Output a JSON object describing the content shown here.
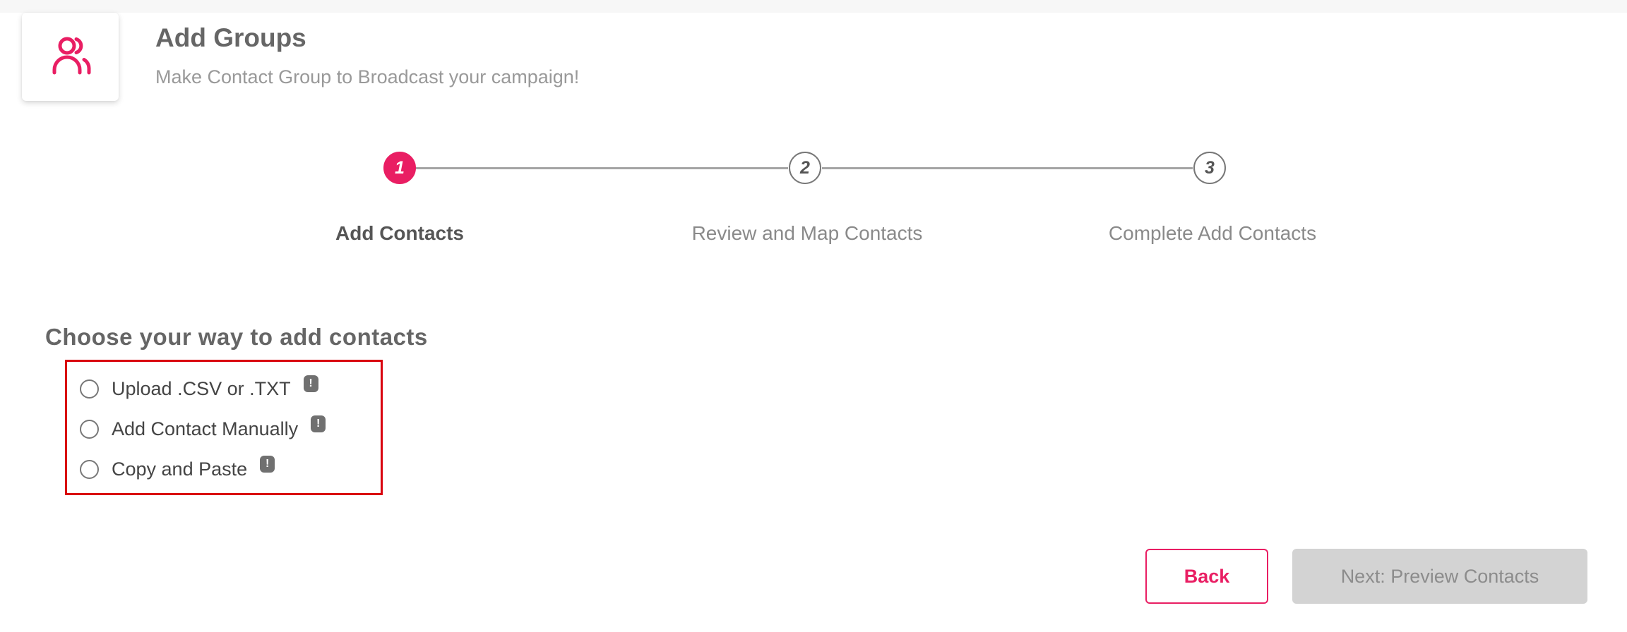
{
  "header": {
    "icon": "user-group-icon",
    "title": "Add Groups",
    "subtitle": "Make Contact Group to Broadcast your campaign!"
  },
  "stepper": {
    "steps": [
      {
        "number": "1",
        "label": "Add Contacts",
        "active": true
      },
      {
        "number": "2",
        "label": "Review and Map Contacts",
        "active": false
      },
      {
        "number": "3",
        "label": "Complete Add Contacts",
        "active": false
      }
    ]
  },
  "main": {
    "heading": "Choose your way to add contacts",
    "options": [
      {
        "label": "Upload .CSV or .TXT",
        "selected": false,
        "info_icon": "info-icon",
        "info_glyph": "!"
      },
      {
        "label": "Add Contact Manually",
        "selected": false,
        "info_icon": "info-icon",
        "info_glyph": "!"
      },
      {
        "label": "Copy and Paste",
        "selected": false,
        "info_icon": "info-icon",
        "info_glyph": "!"
      }
    ]
  },
  "footer": {
    "back_label": "Back",
    "next_label": "Next: Preview Contacts"
  },
  "colors": {
    "accent": "#e91e63",
    "highlight_border": "#d9000d",
    "disabled_button": "#d3d3d3"
  }
}
